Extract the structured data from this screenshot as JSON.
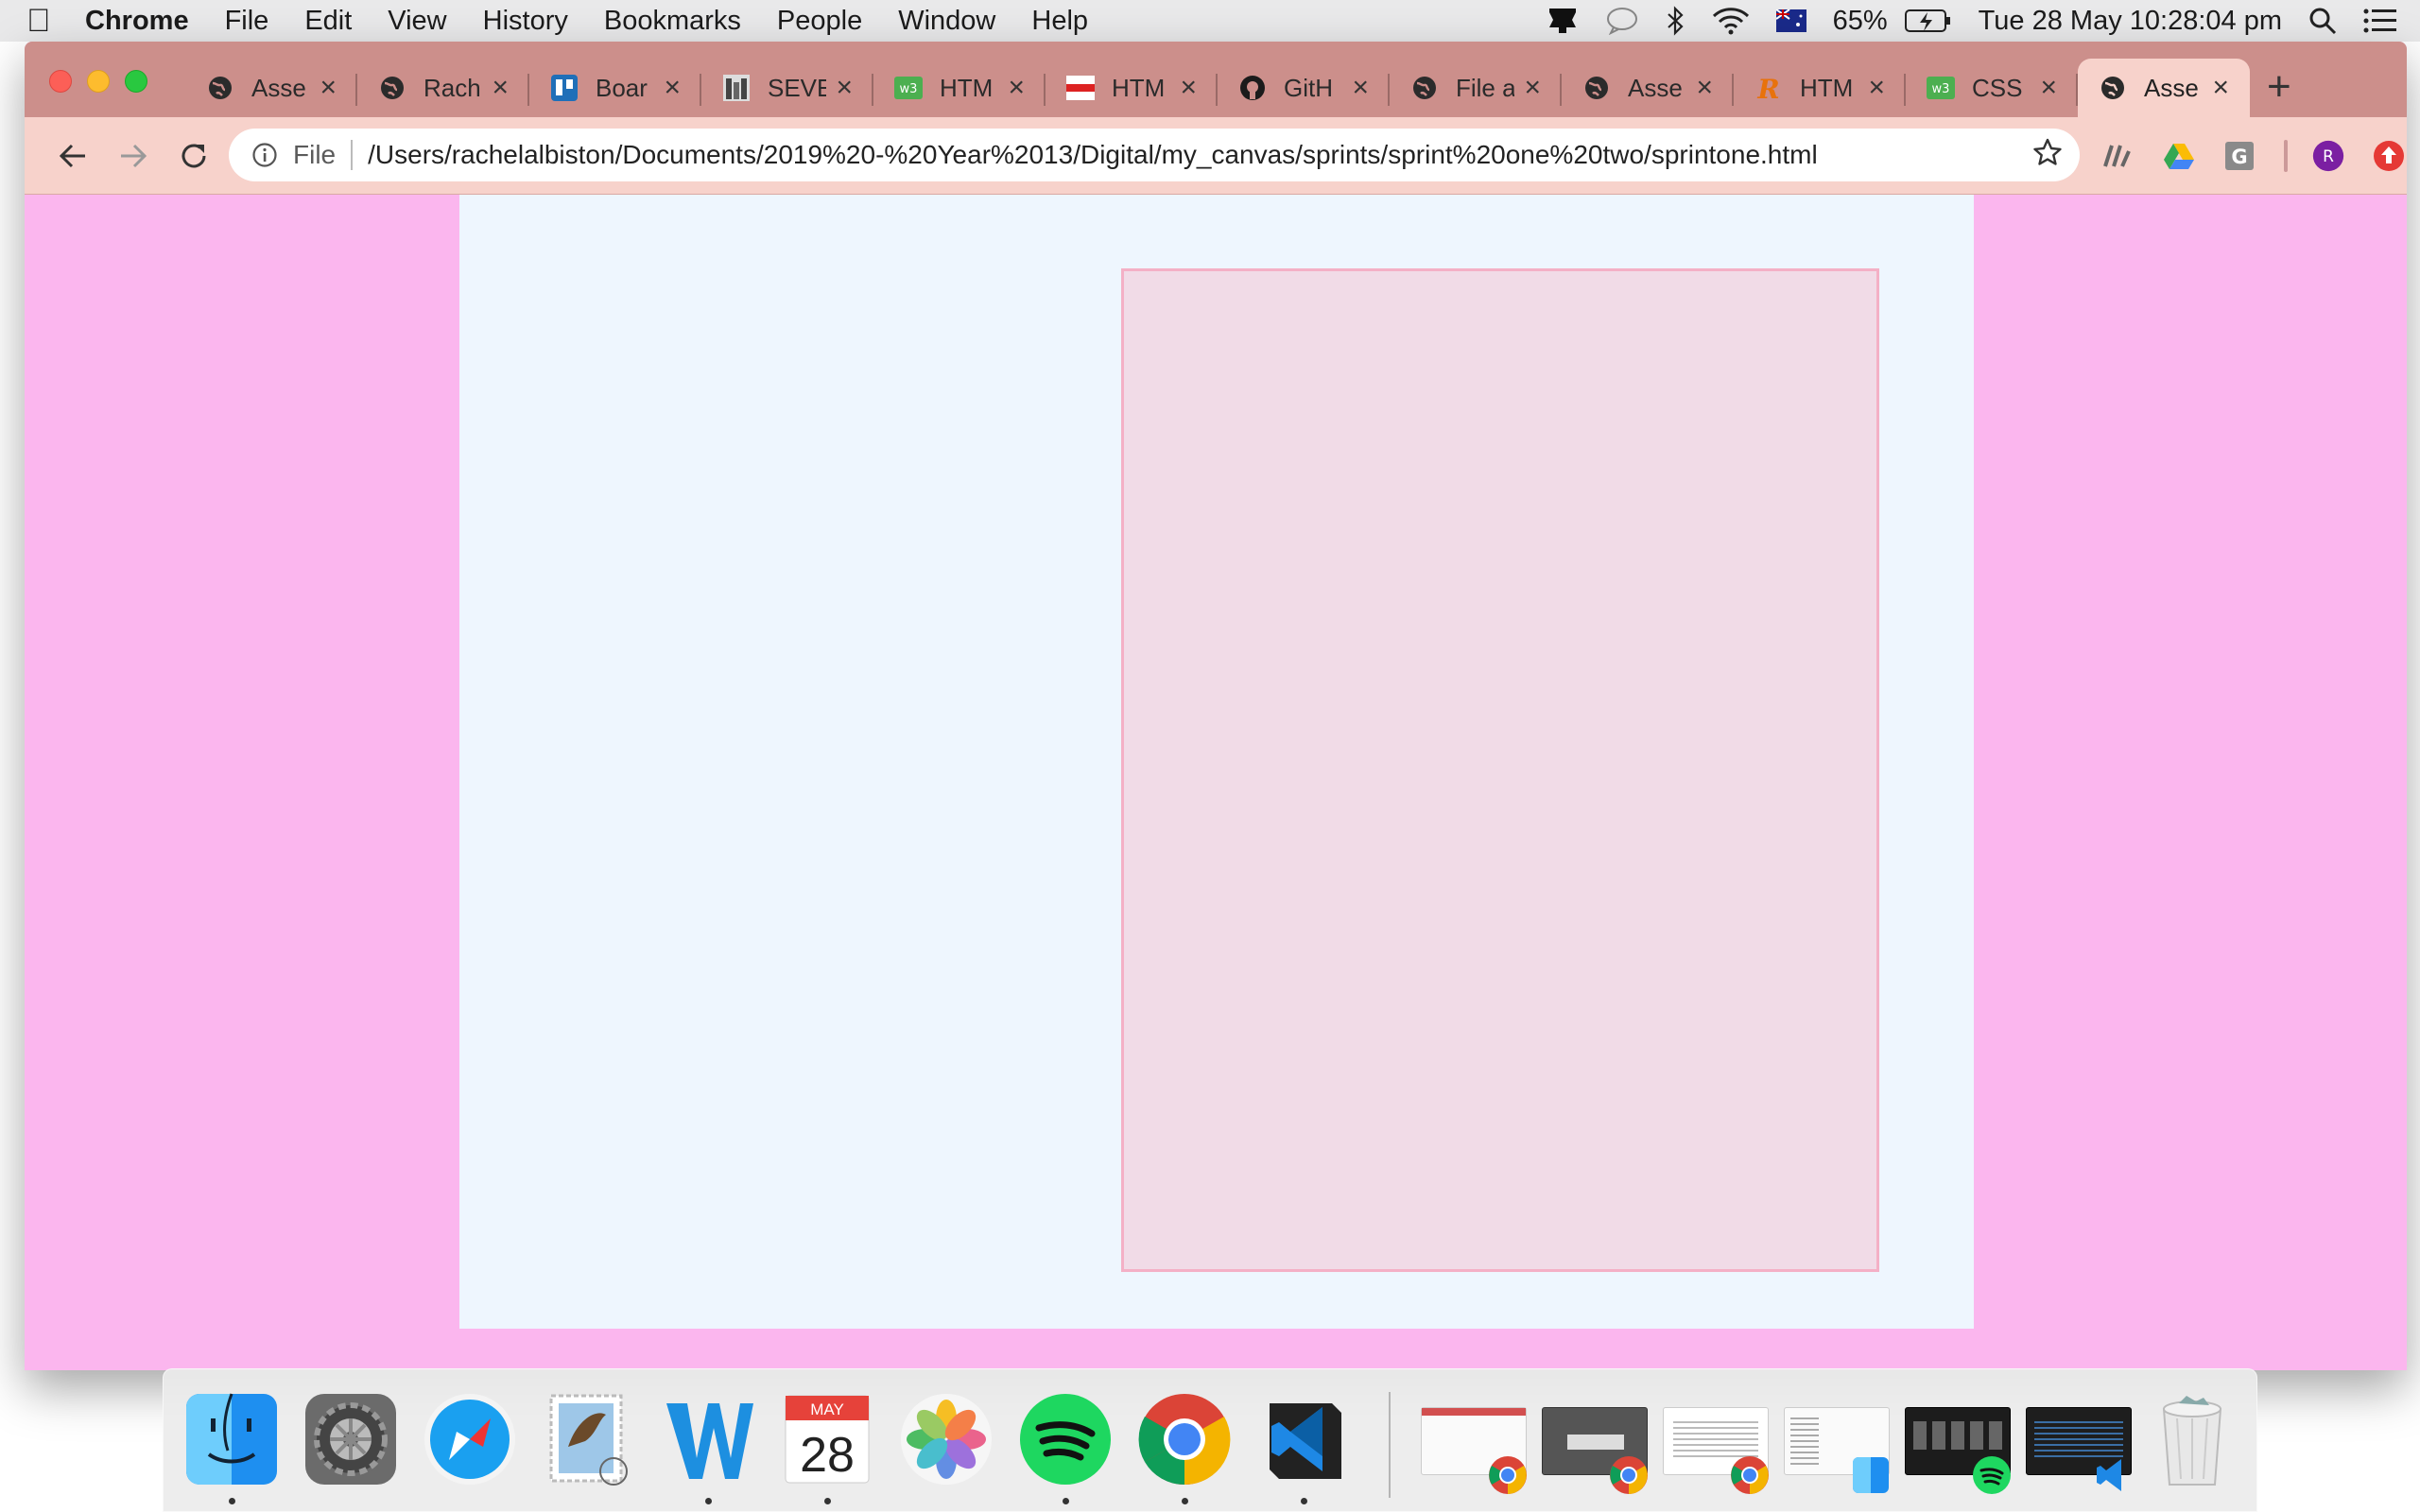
{
  "menubar": {
    "app_name": "Chrome",
    "menus": [
      "File",
      "Edit",
      "View",
      "History",
      "Bookmarks",
      "People",
      "Window",
      "Help"
    ],
    "battery": "65%",
    "datetime": "Tue 28 May  10:28:04 pm"
  },
  "tabs": [
    {
      "label": "Asse",
      "favicon": "globe-icon"
    },
    {
      "label": "Rach",
      "favicon": "globe-icon"
    },
    {
      "label": "Boar",
      "favicon": "trello-icon"
    },
    {
      "label": "SEVE",
      "favicon": "sevenhills-icon"
    },
    {
      "label": "HTM",
      "favicon": "w3schools-icon"
    },
    {
      "label": "HTM",
      "favicon": "html-red-icon"
    },
    {
      "label": "GitH",
      "favicon": "github-icon"
    },
    {
      "label": "File a",
      "favicon": "globe-icon"
    },
    {
      "label": "Asse",
      "favicon": "globe-icon"
    },
    {
      "label": "HTM",
      "favicon": "r-icon"
    },
    {
      "label": "CSS",
      "favicon": "w3schools-icon"
    },
    {
      "label": "Asse",
      "favicon": "globe-icon",
      "active": true
    }
  ],
  "omnibox": {
    "scheme": "File",
    "url": "/Users/rachelalbiston/Documents/2019%20-%20Year%2013/Digital/my_canvas/sprints/sprint%20one%20two/sprintone.html"
  },
  "profile": {
    "initial": "R"
  },
  "dock": {
    "calendar_month": "MAY",
    "calendar_day": "28",
    "apps": [
      "finder",
      "system-preferences",
      "safari",
      "mail",
      "word",
      "calendar",
      "photos",
      "spotify",
      "chrome",
      "vscode"
    ]
  },
  "colors": {
    "page_bg": "#fbb6ee",
    "container_bg": "#eef6fe",
    "canvas_bg": "#f1dbe7",
    "canvas_border": "#f4b0c6",
    "tabstrip": "#cc8f8b",
    "toolbar": "#f7d2cb"
  }
}
